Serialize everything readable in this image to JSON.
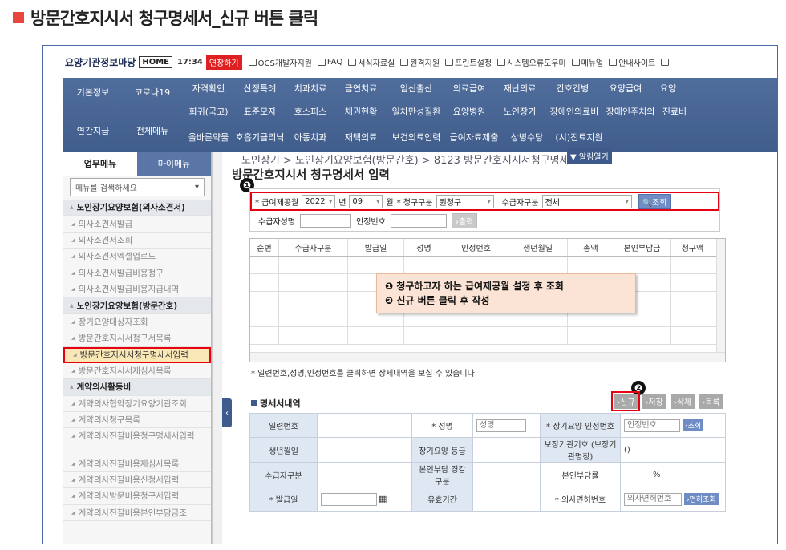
{
  "page_title": "방문간호지시서 청구명세서_신규 버튼 클릭",
  "topbar": {
    "logo": "요양기관정보마당",
    "home": "HOME",
    "time": "17:34",
    "extend": "연장하기",
    "links": [
      "OCS개발자지원",
      "FAQ",
      "서식자료실",
      "원격지원",
      "프린트설정",
      "시스템오류도우미",
      "메뉴얼",
      "안내사이트"
    ]
  },
  "nav": {
    "left": [
      "기본정보",
      "코로나19",
      "연간지급",
      "전체메뉴"
    ],
    "row1": [
      "자격확인",
      "산정특례",
      "치과치료",
      "금연치료",
      "임신출산",
      "의료급여",
      "재난의료",
      "간호간병",
      "요양급여",
      "요양"
    ],
    "row2": [
      "희귀(국고)",
      "표준모자",
      "호스피스",
      "채권현황",
      "일차만성질환",
      "요양병원",
      "노인장기",
      "장애인의료비",
      "장애인주치의",
      "진료비"
    ],
    "row3": [
      "올바른약물",
      "호흡기클리닉",
      "아동치과",
      "재택의료",
      "보건의료인력",
      "급여자료제출",
      "상병수당",
      "(시)진료지원"
    ]
  },
  "sidebar": {
    "tabs": [
      "업무메뉴",
      "마이메뉴"
    ],
    "search_placeholder": "메뉴를 검색하세요",
    "items": [
      {
        "label": "노인장기요양보험(의사소견서)",
        "type": "section"
      },
      {
        "label": "의사소견서발급",
        "type": "item"
      },
      {
        "label": "의사소견서조회",
        "type": "item"
      },
      {
        "label": "의사소견서엑셀업로드",
        "type": "item"
      },
      {
        "label": "의사소견서발급비용청구",
        "type": "item"
      },
      {
        "label": "의사소견서발급비용지급내역",
        "type": "item"
      },
      {
        "label": "노인장기요양보험(방문간호)",
        "type": "section"
      },
      {
        "label": "장기요양대상자조회",
        "type": "item"
      },
      {
        "label": "방문간호지시서청구서목록",
        "type": "item"
      },
      {
        "label": "방문간호지시서청구명세서입력",
        "type": "active"
      },
      {
        "label": "방문간호지시서재심사목록",
        "type": "item"
      },
      {
        "label": "계약의사활동비",
        "type": "section"
      },
      {
        "label": "계약의사협약장기요양기관조회",
        "type": "item"
      },
      {
        "label": "계약의사청구목록",
        "type": "item"
      },
      {
        "label": "계약의사진찰비용청구명세서입력",
        "type": "two"
      },
      {
        "label": "계약의사진찰비용재심사목록",
        "type": "item"
      },
      {
        "label": "계약의사진찰비용신청서입력",
        "type": "item"
      },
      {
        "label": "계약의사방문비용청구서입력",
        "type": "item"
      },
      {
        "label": "계약의사진찰비용본인부담금조",
        "type": "item"
      }
    ]
  },
  "breadcrumb": "노인장기 > 노인장기요양보험(방문간호) > 8123 방문간호지시서청구명세서",
  "alert_button": "▼ 알림열기",
  "form_title": "방문간호지시서 청구명세서 입력",
  "markers": [
    "❶",
    "❷"
  ],
  "criteria": {
    "period_label": "* 급여제공월",
    "year": "2022",
    "year_unit": "년",
    "month": "09",
    "month_unit": "월",
    "claim_type_label": "* 청구구분",
    "claim_type": "원청구",
    "recipient_type_label": "수급자구분",
    "recipient_type": "전체",
    "search_button": "조회",
    "recipient_name_label": "수급자성명",
    "cert_no_label": "인정번호",
    "print_button": "출력"
  },
  "grid_columns": [
    "순번",
    "수급자구분",
    "발급일",
    "성명",
    "인정번호",
    "생년월일",
    "총액",
    "본인부담금",
    "청구액"
  ],
  "callout": {
    "line1": "❶ 청구하고자 하는 급여제공월 설정 후 조회",
    "line2": "❷ 신규 버튼 클릭 후 작성"
  },
  "note": "* 일련번호,성명,인정번호를 클릭하면 상세내역을 보실 수 있습니다.",
  "detail": {
    "section_title": "명세서내역",
    "buttons": [
      "신규",
      "저장",
      "삭제",
      "목록"
    ],
    "labels": {
      "serial": "일련번호",
      "name": "* 성명",
      "ltc_cert": "* 장기요양 인정번호",
      "birth": "생년월일",
      "ltc_grade": "장기요양 등급",
      "agency": "보장기관기호 (보장기관명칭)",
      "recipient_type": "수급자구분",
      "copay_reduce": "본인부담 경감구분",
      "copay_rate": "본인부담률",
      "issue_date": "* 발급일",
      "valid": "유효기간",
      "doctor_license": "* 의사면허번호"
    },
    "values": {
      "name_ph": "성명",
      "cert_ph": "인정번호",
      "cert_btn": "조회",
      "agency_val": "()",
      "rate_val": "%",
      "license_ph": "의사면허번호",
      "license_btn": "면허조회"
    }
  }
}
